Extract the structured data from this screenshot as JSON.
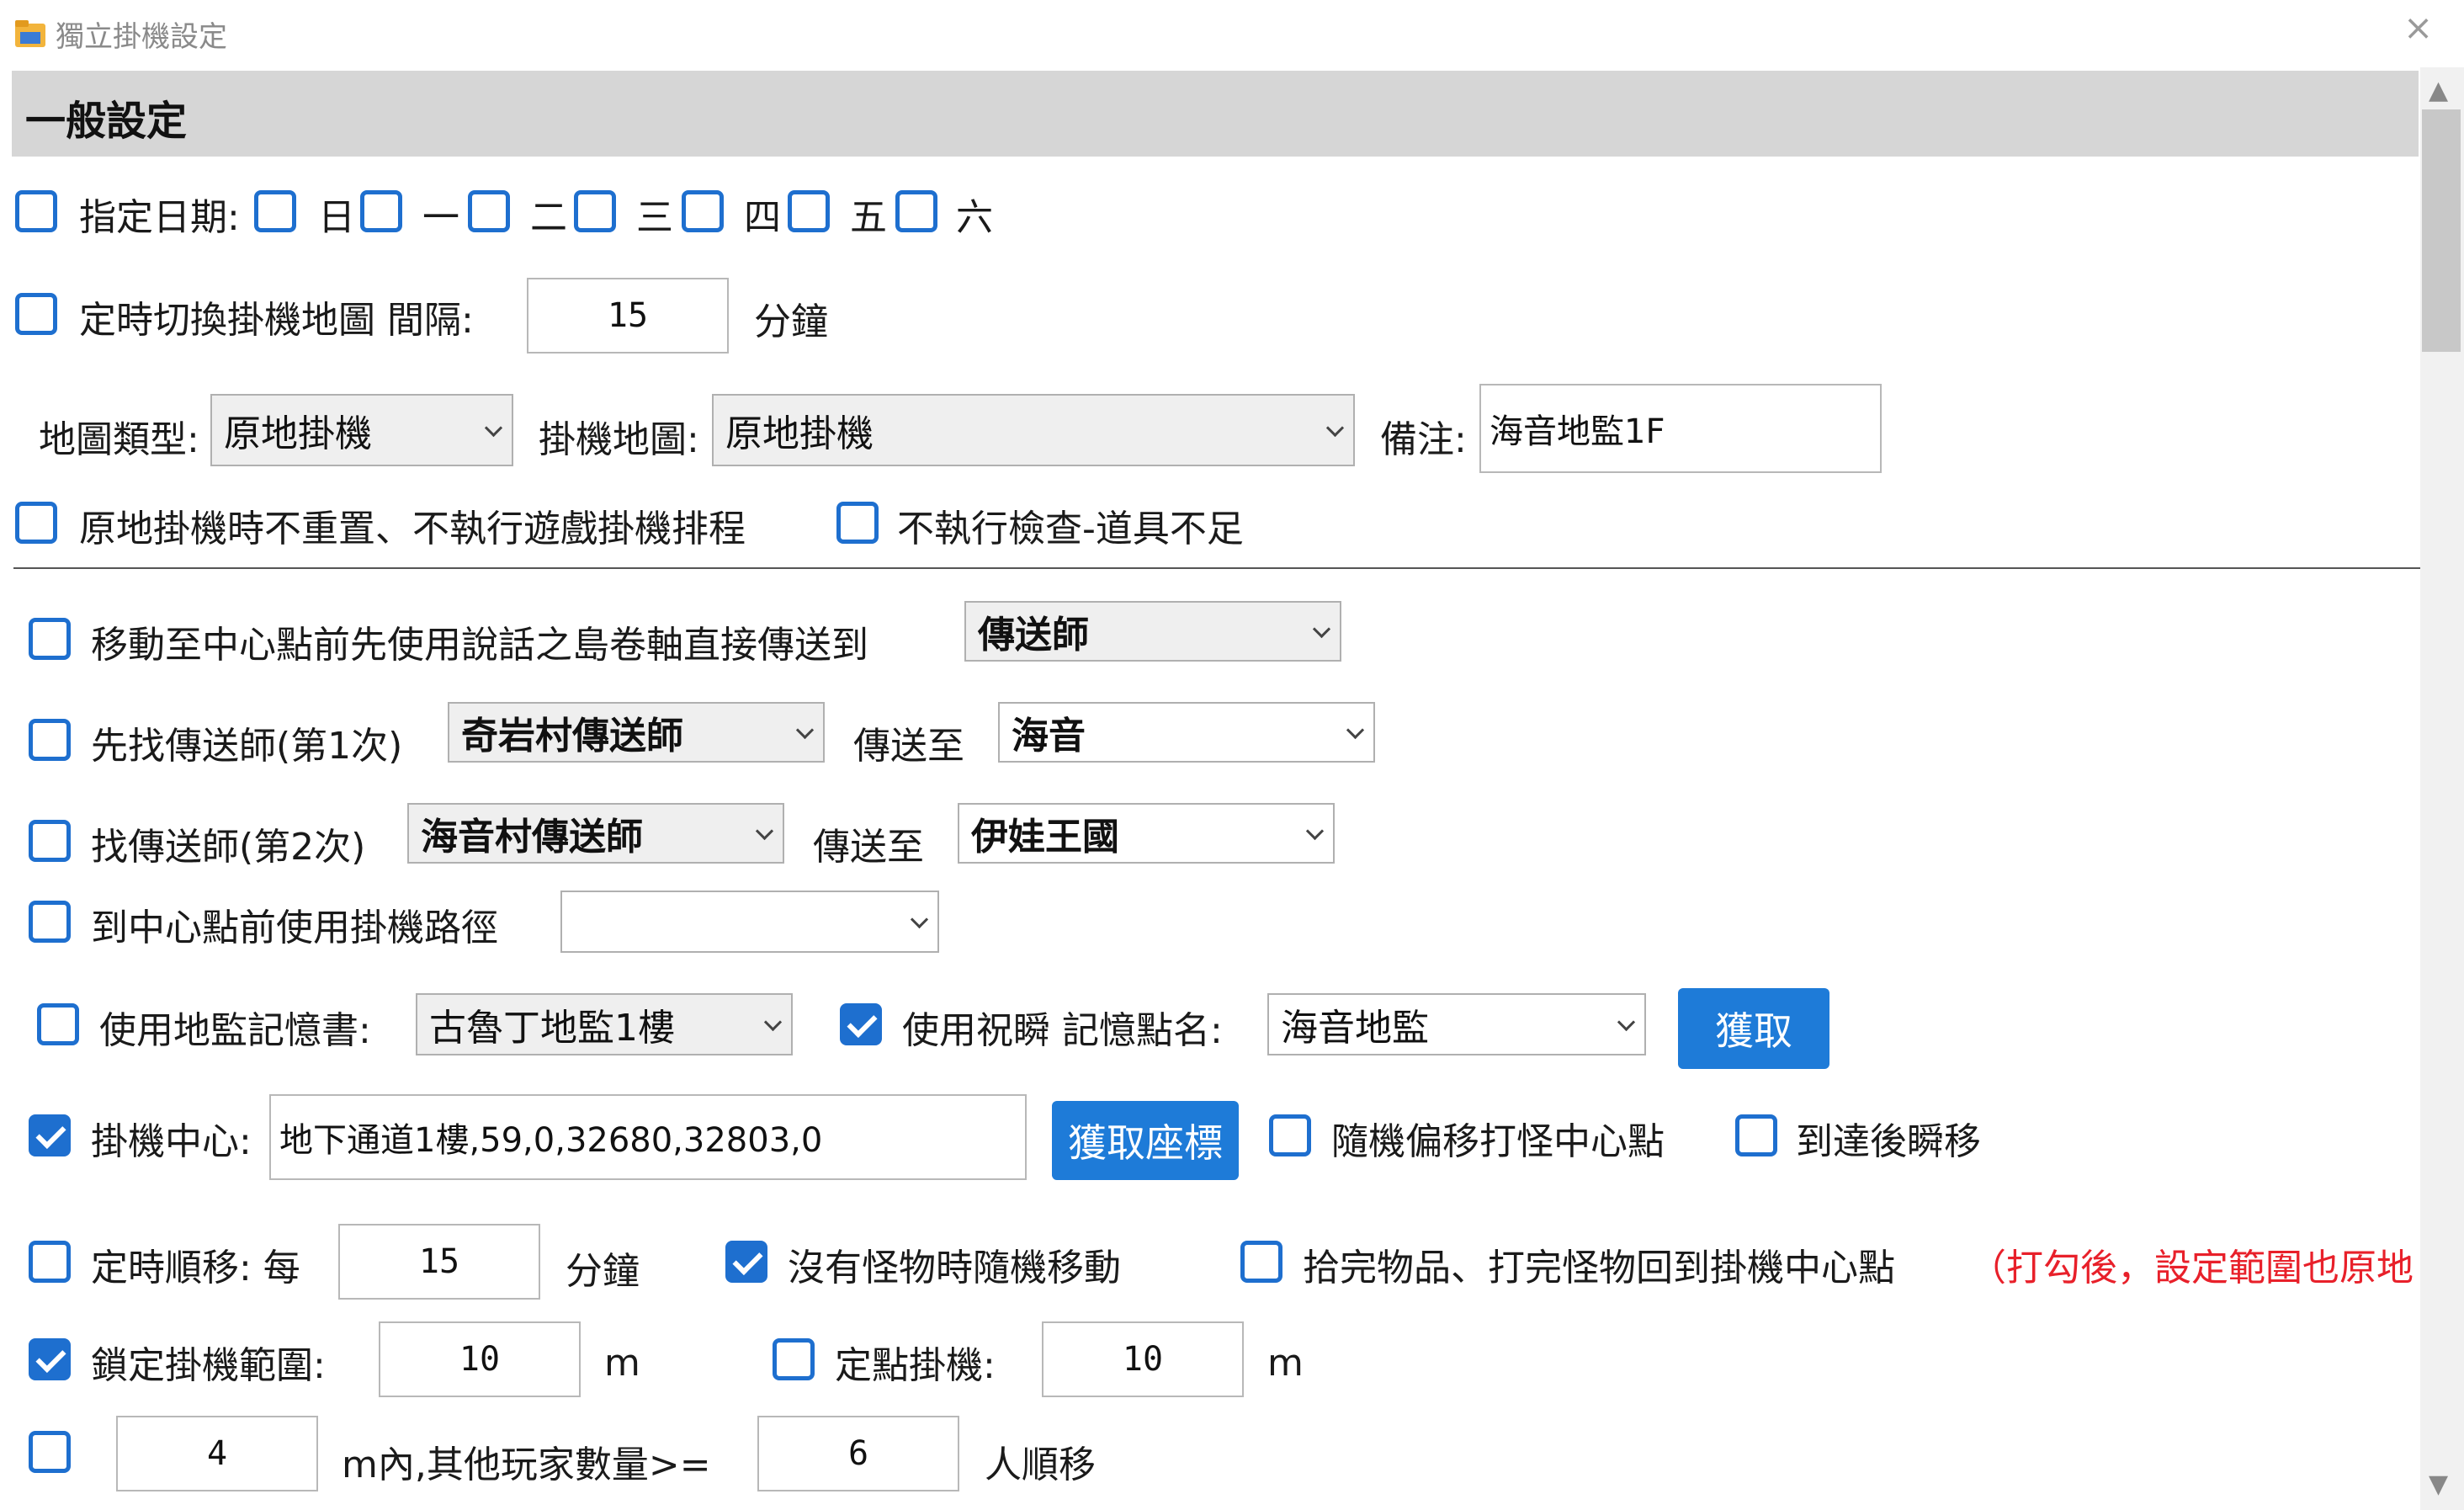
{
  "window": {
    "title": "獨立掛機設定",
    "close": "×"
  },
  "section": {
    "title": "一般設定"
  },
  "row_days": {
    "label": "指定日期:",
    "days": [
      "日",
      "一",
      "二",
      "三",
      "四",
      "五",
      "六"
    ]
  },
  "row_switch": {
    "label": "定時切換掛機地圖 間隔:",
    "value": "15",
    "unit": "分鐘"
  },
  "row_map": {
    "type_label": "地圖類型:",
    "type_value": "原地掛機",
    "map_label": "掛機地圖:",
    "map_value": "原地掛機",
    "note_label": "備注:",
    "note_value": "海音地監1F"
  },
  "row_options": {
    "no_reset": "原地掛機時不重置、不執行遊戲掛機排程",
    "no_check": "不執行檢查-道具不足"
  },
  "row_move": {
    "label": "移動至中心點前先使用說話之島卷軸直接傳送到",
    "value": "傳送師"
  },
  "row_tele1": {
    "label": "先找傳送師(第1次)",
    "npc": "奇岩村傳送師",
    "to_label": "傳送至",
    "dest": "海音"
  },
  "row_tele2": {
    "label": "找傳送師(第2次)",
    "npc": "海音村傳送師",
    "to_label": "傳送至",
    "dest": "伊娃王國"
  },
  "row_path": {
    "label": "到中心點前使用掛機路徑",
    "value": ""
  },
  "row_memory": {
    "book_label": "使用地監記憶書:",
    "book_value": "古魯丁地監1樓",
    "bless_label": "使用祝瞬 記憶點名:",
    "bless_value": "海音地監",
    "fetch": "獲取"
  },
  "row_center": {
    "label": "掛機中心:",
    "value": "地下通道1樓,59,0,32680,32803,0",
    "fetch": "獲取座標",
    "random": "隨機偏移打怪中心點",
    "teleport": "到達後瞬移"
  },
  "row_timed": {
    "label": "定時順移: 每",
    "value": "15",
    "unit": "分鐘",
    "random_move": "沒有怪物時隨機移動",
    "return_center": "拾完物品、打完怪物回到掛機中心點",
    "note": "（打勾後，設定範圍也原地"
  },
  "row_lock": {
    "label": "鎖定掛機範圍:",
    "value": "10",
    "unit": "m",
    "fixed_label": "定點掛機:",
    "fixed_value": "10",
    "fixed_unit": "m"
  },
  "row_players": {
    "distance": "4",
    "mid_label": "m內,其他玩家數量>=",
    "count": "6",
    "suffix": "人順移"
  },
  "colors": {
    "accent": "#1e6fcf",
    "button": "#1e7bd8",
    "warning": "#e8202a",
    "header_bg": "#d6d6d6"
  },
  "checkbox_states": {
    "days": false,
    "switch": false,
    "no_reset": false,
    "no_check": false,
    "move": false,
    "tele1": false,
    "tele2": false,
    "path": false,
    "book": false,
    "bless": true,
    "center": true,
    "random": false,
    "teleport": false,
    "timed": false,
    "random_move": true,
    "return_center": false,
    "lock": true,
    "fixed": false,
    "players": false
  }
}
